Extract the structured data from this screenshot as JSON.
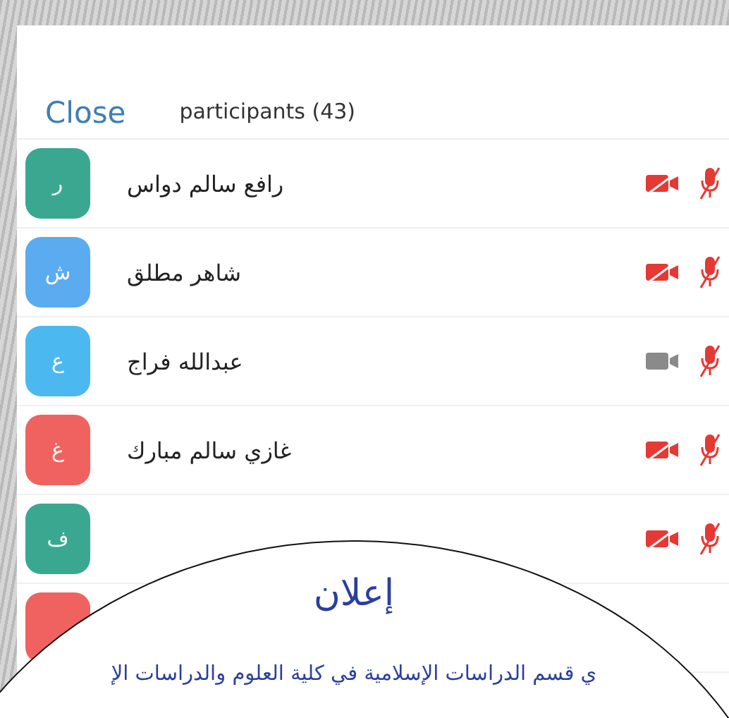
{
  "header": {
    "close": "Close",
    "title": "participants (43)"
  },
  "participants": [
    {
      "initial": "ر",
      "name": "رافع سالم دواس",
      "color": "#3aa891",
      "video_off": true,
      "muted": true
    },
    {
      "initial": "ش",
      "name": "شاهر مطلق",
      "color": "#5aabef",
      "video_off": true,
      "muted": true
    },
    {
      "initial": "ع",
      "name": "عبدالله فراج",
      "color": "#4cb8f0",
      "video_off": false,
      "muted": true
    },
    {
      "initial": "غ",
      "name": "غازي سالم مبارك",
      "color": "#f0625f",
      "video_off": true,
      "muted": true
    },
    {
      "initial": "ف",
      "color": "#3aa891",
      "video_off": true,
      "muted": true
    },
    {
      "color": "#f0625f"
    }
  ],
  "announcement": {
    "title": "إعلان",
    "text": "ي قسم الدراسات الإسلامية في كلية العلوم والدراسات الإ"
  }
}
